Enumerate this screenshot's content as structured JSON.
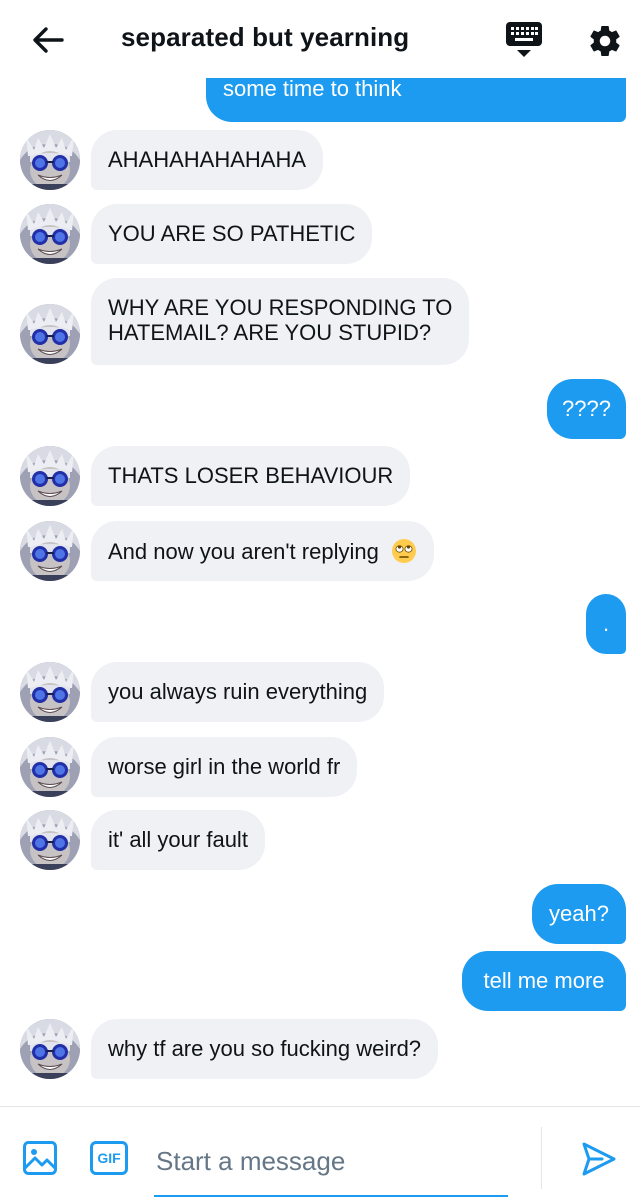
{
  "header": {
    "title": "separated but yearning",
    "back_icon": "arrow-left-icon",
    "keyboard_icon": "keyboard-icon",
    "settings_icon": "gear-icon"
  },
  "theme": {
    "accent": "#1d9bf0",
    "incoming_bubble": "#eff1f4",
    "text": "#0f1419",
    "placeholder": "#657786"
  },
  "messages": [
    {
      "direction": "out",
      "text": "some time to think"
    },
    {
      "direction": "in",
      "text": "AHAHAHAHAHAHA"
    },
    {
      "direction": "in",
      "text": "YOU ARE SO PATHETIC"
    },
    {
      "direction": "in",
      "line1": "WHY ARE YOU RESPONDING TO",
      "line2": "HATEMAIL? ARE YOU STUPID?"
    },
    {
      "direction": "out",
      "text": "????"
    },
    {
      "direction": "in",
      "text": "THATS LOSER BEHAVIOUR"
    },
    {
      "direction": "in",
      "text": "And now you aren't replying",
      "emoji": "eye-roll-emoji"
    },
    {
      "direction": "out",
      "text": "."
    },
    {
      "direction": "in",
      "text": "you always ruin everything"
    },
    {
      "direction": "in",
      "text": "worse girl in the world fr"
    },
    {
      "direction": "in",
      "text": "it' all your fault"
    },
    {
      "direction": "out",
      "text": "yeah?"
    },
    {
      "direction": "out",
      "text": "tell me more"
    },
    {
      "direction": "in",
      "text": "why tf are you so fucking weird?"
    }
  ],
  "composer": {
    "placeholder": "Start a message",
    "gif_label": "GIF",
    "image_icon": "image-icon",
    "send_icon": "send-icon"
  }
}
